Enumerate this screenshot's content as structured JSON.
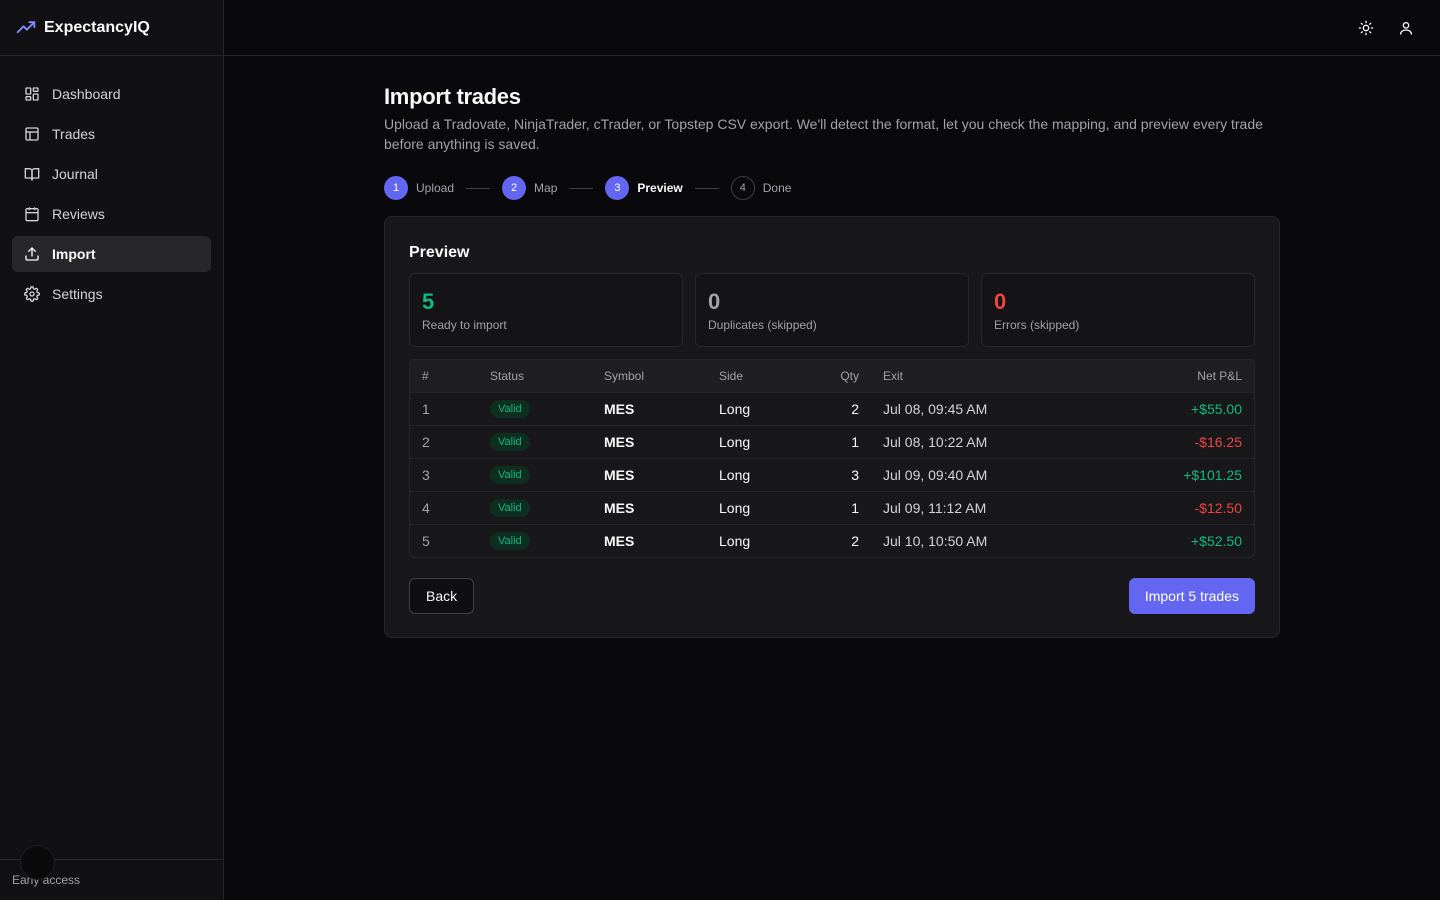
{
  "app": {
    "name": "ExpectancyIQ"
  },
  "sidebar": {
    "items": [
      {
        "label": "Dashboard",
        "icon": "dashboard-icon"
      },
      {
        "label": "Trades",
        "icon": "table-icon"
      },
      {
        "label": "Journal",
        "icon": "book-icon"
      },
      {
        "label": "Reviews",
        "icon": "calendar-icon"
      },
      {
        "label": "Import",
        "icon": "upload-icon",
        "active": true
      },
      {
        "label": "Settings",
        "icon": "gear-icon"
      }
    ],
    "footer": "Early access"
  },
  "topbar": {
    "theme_icon": "sun-icon",
    "user_icon": "user-icon"
  },
  "page": {
    "title": "Import trades",
    "subtitle": "Upload a Tradovate, NinjaTrader, cTrader, or Topstep CSV export. We'll detect the format, let you check the mapping, and preview every trade before anything is saved."
  },
  "stepper": [
    {
      "num": "1",
      "label": "Upload",
      "state": "done"
    },
    {
      "num": "2",
      "label": "Map",
      "state": "done"
    },
    {
      "num": "3",
      "label": "Preview",
      "state": "current"
    },
    {
      "num": "4",
      "label": "Done",
      "state": "todo"
    }
  ],
  "preview": {
    "title": "Preview",
    "stats": [
      {
        "value": "5",
        "caption": "Ready to import",
        "color": "#10b981"
      },
      {
        "value": "0",
        "caption": "Duplicates (skipped)",
        "color": "#a1a1aa"
      },
      {
        "value": "0",
        "caption": "Errors (skipped)",
        "color": "#ef4444"
      }
    ],
    "columns": [
      "#",
      "Status",
      "Symbol",
      "Side",
      "Qty",
      "Exit",
      "Net P&L"
    ],
    "rows": [
      {
        "idx": "1",
        "status": "Valid",
        "symbol": "MES",
        "side": "Long",
        "qty": "2",
        "exit": "Jul 08, 09:45 AM",
        "pnl": "+$55.00"
      },
      {
        "idx": "2",
        "status": "Valid",
        "symbol": "MES",
        "side": "Long",
        "qty": "1",
        "exit": "Jul 08, 10:22 AM",
        "pnl": "-$16.25"
      },
      {
        "idx": "3",
        "status": "Valid",
        "symbol": "MES",
        "side": "Long",
        "qty": "3",
        "exit": "Jul 09, 09:40 AM",
        "pnl": "+$101.25"
      },
      {
        "idx": "4",
        "status": "Valid",
        "symbol": "MES",
        "side": "Long",
        "qty": "1",
        "exit": "Jul 09, 11:12 AM",
        "pnl": "-$12.50"
      },
      {
        "idx": "5",
        "status": "Valid",
        "symbol": "MES",
        "side": "Long",
        "qty": "2",
        "exit": "Jul 10, 10:50 AM",
        "pnl": "+$52.50"
      }
    ],
    "back_label": "Back",
    "import_label": "Import 5 trades"
  },
  "colors": {
    "accent": "#6366f1",
    "positive": "#10b981",
    "negative": "#ef4444"
  }
}
